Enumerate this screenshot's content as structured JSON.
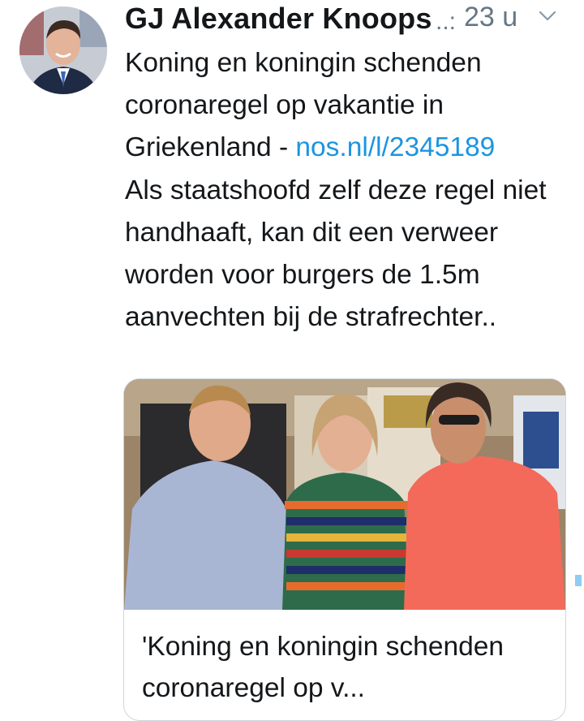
{
  "tweet": {
    "author_name": "GJ Alexander Knoops",
    "truncation": "..:",
    "time": "23 u",
    "text_before_link": "Koning en koningin schenden coronaregel op vakantie in Griekenland - ",
    "link": "nos.nl/l/2345189",
    "text_after_link": "Als staatshoofd zelf deze regel niet handhaaft, kan dit een verweer worden voor burgers de 1.5m aanvechten bij de strafrechter.."
  },
  "card": {
    "title": "'Koning en koningin schenden coronaregel op v..."
  },
  "colors": {
    "link": "#1b95e0",
    "muted": "#657786",
    "border": "#ccd6dd"
  },
  "icons": {
    "menu": "chevron-down-icon"
  }
}
